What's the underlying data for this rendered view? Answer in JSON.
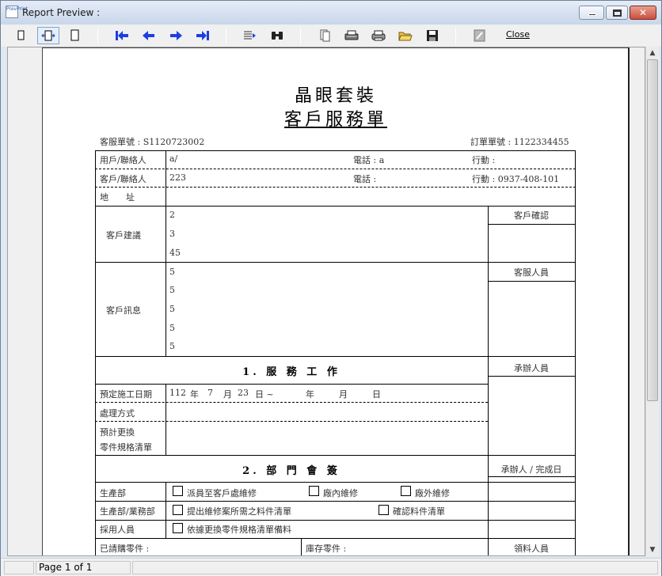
{
  "window": {
    "title": "Report Preview :",
    "close_label": "Close",
    "app_icon_text": "PrevPrint"
  },
  "status": {
    "page_label": "Page 1 of 1"
  },
  "report": {
    "title_line1": "晶眼套裝",
    "title_line2": "客戶服務單",
    "service_no_label": "客服單號 : S1120723002",
    "order_no_label": "訂單單號 : 1122334455",
    "rows": {
      "r1_label": "用戶/聯絡人",
      "r1_value": "a/",
      "r1_phone": "電話 : a",
      "r1_mobile": "行動 :",
      "r2_label": "客戶/聯絡人",
      "r2_value": "223",
      "r2_phone": "電話 :",
      "r2_mobile": "行動 : 0937-408-101",
      "address_label": "地　　址"
    },
    "suggestion": {
      "label": "客戶建議",
      "lines": [
        "2",
        "3",
        "45"
      ],
      "side_label": "客戶確認"
    },
    "message": {
      "label": "客戶訊息",
      "lines": [
        "5",
        "5",
        "5",
        "5",
        "5"
      ],
      "side_label": "客服人員"
    },
    "section1": {
      "title": "1. 服 務 工 作",
      "side_label": "承辦人員",
      "date_label": "預定施工日期",
      "date_y": "112",
      "date_year": "年",
      "date_m": "7",
      "date_month": "月",
      "date_d": "23",
      "date_day": "日 ~",
      "date_year2": "年",
      "date_month2": "月",
      "date_day2": "日",
      "method_label": "處理方式",
      "parts_label1": "預計更換",
      "parts_label2": "零件規格清單"
    },
    "section2": {
      "title": "2. 部 門 會 簽",
      "side_label": "承辦人 / 完成日",
      "prod_label": "生產部",
      "prod_opt1": "派員至客戶處維修",
      "prod_opt2": "廠內維修",
      "prod_opt3": "廠外維修",
      "sales_label": "生產部/業務部",
      "sales_opt1": "提出維修案所需之料件清單",
      "sales_opt2": "確認料件清單",
      "buy_label": "採用人員",
      "buy_opt1": "依據更換零件規格清單備料",
      "ordered_label": "已請購零件 :",
      "stock_label": "庫存零件 :",
      "collect_label": "領料人員"
    }
  }
}
